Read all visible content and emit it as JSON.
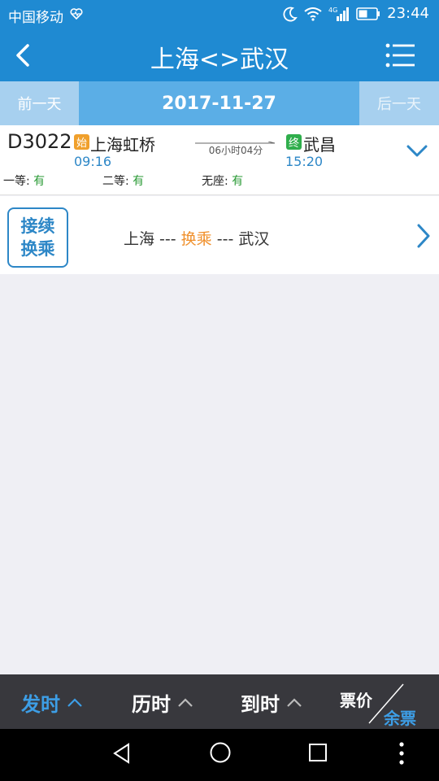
{
  "status_bar": {
    "carrier": "中国移动",
    "time": "23:44",
    "network": "4G"
  },
  "header": {
    "title": "上海<>武汉",
    "back_icon": "chevron-left-icon",
    "menu_icon": "list-menu-icon"
  },
  "date_bar": {
    "prev_label": "前一天",
    "date": "2017-11-27",
    "next_label": "后一天"
  },
  "train": {
    "number": "D3022",
    "start_badge": "始",
    "from_station": "上海虹桥",
    "departure_time": "09:16",
    "duration": "06小时04分",
    "end_badge": "终",
    "to_station": "武昌",
    "arrival_time": "15:20",
    "seats": [
      {
        "class": "一等",
        "availability": "有"
      },
      {
        "class": "二等",
        "availability": "有"
      },
      {
        "class": "无座",
        "availability": "有"
      }
    ]
  },
  "transfer": {
    "badge_line1": "接续",
    "badge_line2": "换乘",
    "from": "上海",
    "sep1": " --- ",
    "via": "换乘",
    "sep2": " --- ",
    "to": "武汉"
  },
  "sort_bar": {
    "items": [
      {
        "label": "发时",
        "active": true
      },
      {
        "label": "历时",
        "active": false
      },
      {
        "label": "到时",
        "active": false
      }
    ],
    "price_label": "票价",
    "remaining_label": "余票"
  },
  "colors": {
    "primary": "#1f8ad2",
    "accent": "#f0902c",
    "available": "#2a9a35",
    "sortbar": "#38383d"
  }
}
